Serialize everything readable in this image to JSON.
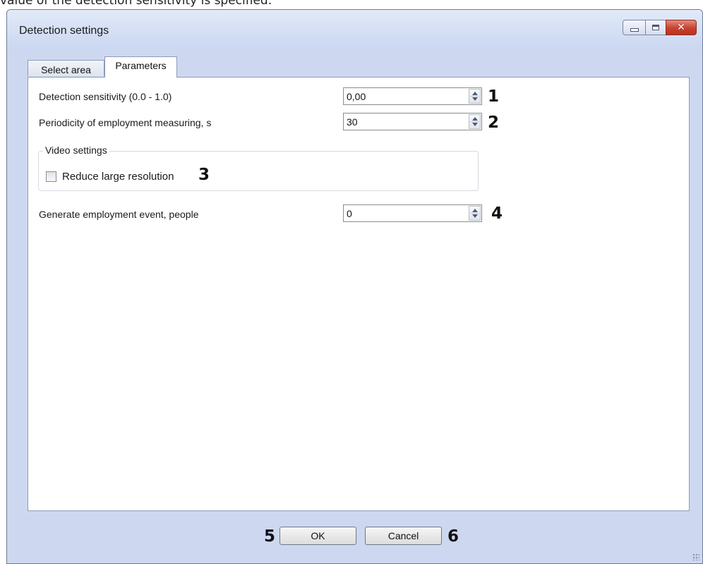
{
  "caption": "value of the detection sensitivity is specified.",
  "window": {
    "title": "Detection settings",
    "controls": {
      "minimize_icon": "minimize-icon",
      "maximize_icon": "maximize-icon",
      "close_glyph": "✕"
    }
  },
  "tabs": [
    {
      "label": "Select area",
      "active": false
    },
    {
      "label": "Parameters",
      "active": true
    }
  ],
  "params": {
    "sensitivity": {
      "label": "Detection sensitivity (0.0 - 1.0)",
      "value": "0,00",
      "marker": "1"
    },
    "periodicity": {
      "label": "Periodicity of employment measuring, s",
      "value": "30",
      "marker": "2"
    },
    "video_settings": {
      "title": "Video settings",
      "reduce_resolution": {
        "label": "Reduce large resolution",
        "checked": false,
        "marker": "3"
      }
    },
    "employment_event": {
      "label": "Generate employment event, people",
      "value": "0",
      "marker": "4"
    }
  },
  "footer": {
    "ok_label": "OK",
    "ok_marker": "5",
    "cancel_label": "Cancel",
    "cancel_marker": "6"
  },
  "colors": {
    "window_frame": "#cdd8f0",
    "close_button": "#c9402f",
    "panel_background": "#ffffff"
  }
}
